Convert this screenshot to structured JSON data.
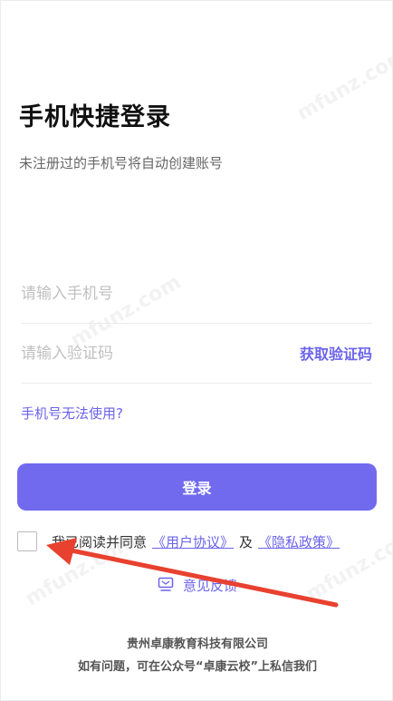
{
  "header": {
    "title": "手机快捷登录",
    "subtitle": "未注册过的手机号将自动创建账号"
  },
  "form": {
    "phone_placeholder": "请输入手机号",
    "code_placeholder": "请输入验证码",
    "get_code_label": "获取验证码",
    "phone_unavailable_label": "手机号无法使用?",
    "login_label": "登录"
  },
  "agreement": {
    "prefix": "我已阅读并同意",
    "user_agreement": "《用户协议》",
    "and": "及",
    "privacy_policy": "《隐私政策》"
  },
  "feedback": {
    "label": "意见反馈"
  },
  "footer": {
    "company": "贵州卓康教育科技有限公司",
    "contact": "如有问题，可在公众号“卓康云校”上私信我们"
  },
  "watermark": "mfunz.com",
  "colors": {
    "accent": "#6b63ea",
    "button": "#716aef",
    "annotation_arrow": "#e8412f"
  }
}
